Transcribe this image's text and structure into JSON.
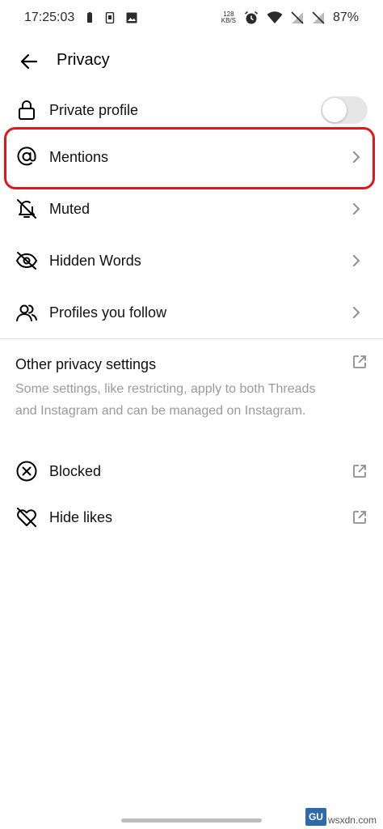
{
  "status_bar": {
    "time": "17:25:03",
    "net_speed_value": "128",
    "net_speed_unit": "KB/S",
    "battery": "87%"
  },
  "header": {
    "title": "Privacy"
  },
  "rows": {
    "private_profile": {
      "label": "Private profile",
      "toggle_on": false
    },
    "mentions": {
      "label": "Mentions"
    },
    "muted": {
      "label": "Muted"
    },
    "hidden_words": {
      "label": "Hidden Words"
    },
    "profiles_you_follow": {
      "label": "Profiles you follow"
    }
  },
  "other_privacy": {
    "title": "Other privacy settings",
    "description": "Some settings, like restricting, apply to both Threads and Instagram and can be managed on Instagram."
  },
  "instagram_rows": {
    "blocked": {
      "label": "Blocked"
    },
    "hide_likes": {
      "label": "Hide likes"
    }
  },
  "watermark": {
    "text": "wsxdn.com",
    "logo_text": "GU"
  },
  "colors": {
    "highlight": "#e0161c",
    "secondary_text": "#9a9a9a",
    "toggle_track": "#e6e6e6"
  },
  "icons": {
    "back": "arrow-left-icon",
    "lock": "lock-icon",
    "mention": "at-sign-icon",
    "muted": "bell-off-icon",
    "hidden_words": "eye-off-icon",
    "profiles": "people-icon",
    "chevron": "chevron-right-icon",
    "external": "external-link-icon",
    "blocked": "circle-x-icon",
    "hide_likes": "heart-off-icon"
  }
}
